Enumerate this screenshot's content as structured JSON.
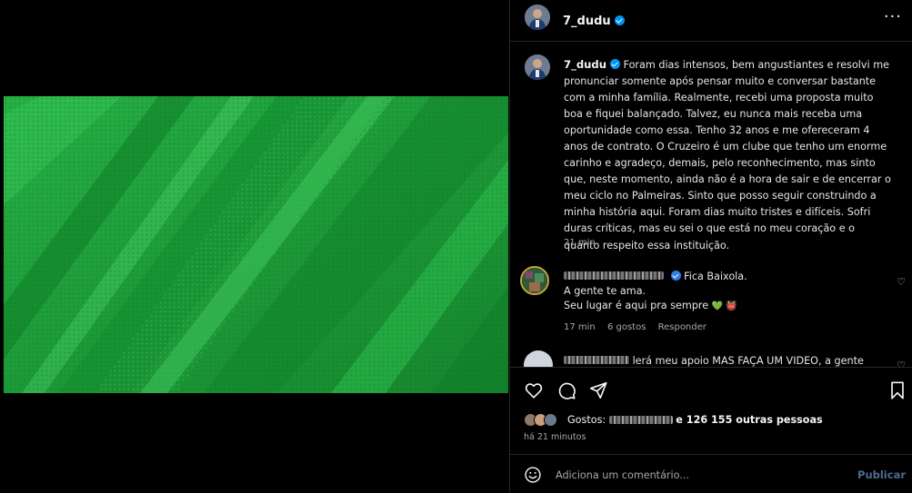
{
  "post": {
    "username": "7_dudu",
    "caption": "Foram dias intensos, bem angustiantes e resolvi me pronunciar somente após pensar muito e conversar bastante com a minha família. Realmente, recebi uma proposta muito boa e fiquei balançado. Talvez, eu nunca mais receba uma oportunidade como essa. Tenho 32 anos e me ofereceram 4 anos de contrato. O Cruzeiro é um clube que tenho um enorme carinho e agradeço, demais, pelo reconhecimento, mas sinto que, neste momento, ainda não é a hora de sair e de encerrar o meu ciclo no Palmeiras. Sinto que posso seguir construindo a minha história aqui. Foram dias muito tristes e difíceis. Sofri duras críticas, mas eu sei o que está no meu coração e o quanto respeito essa instituição.",
    "caption_time": "21 min",
    "more_icon": "more-horizontal-icon"
  },
  "comments": [
    {
      "text_line1": "Fica Baixola.",
      "text_line2": "A gente te ama.",
      "text_line3": "Seu lugar é aqui pra sempre",
      "emojis": "💚 👹",
      "time": "17 min",
      "likes": "6 gostos",
      "reply": "Responder"
    },
    {
      "text": "lerá meu apoio MAS FAÇA UM VIDEO, a gente"
    }
  ],
  "actions": {
    "like_icon": "heart-icon",
    "comment_icon": "comment-icon",
    "share_icon": "send-icon",
    "save_icon": "bookmark-icon"
  },
  "likes": {
    "prefix": "Gostos:",
    "suffix": "e 126 155 outras pessoas",
    "when": "há 21 minutos"
  },
  "comment_box": {
    "placeholder": "Adiciona um comentário...",
    "publish_label": "Publicar"
  },
  "colors": {
    "background": "#000000",
    "media_green": "#1f9d3a",
    "verified_blue": "#0095f6",
    "publish_disabled": "#4b6b8f"
  }
}
